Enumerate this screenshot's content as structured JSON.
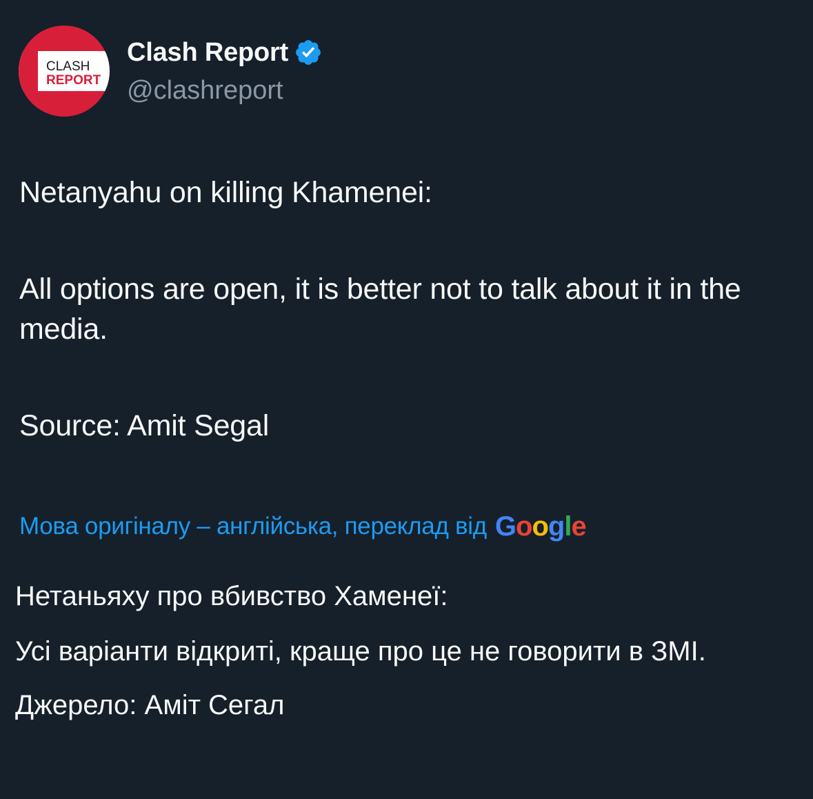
{
  "account": {
    "display_name": "Clash Report",
    "handle": "@clashreport",
    "avatar_logo_line1": "CLASH",
    "avatar_logo_line2": "REPORT",
    "verified": true,
    "avatar_color": "#d81f3a",
    "verified_color": "#1d9bf0"
  },
  "tweet": {
    "paragraphs": [
      "Netanyahu on killing Khamenei:",
      "All options are open, it is better not to talk about it in the media.",
      "Source: Amit Segal"
    ]
  },
  "translation": {
    "note": "Мова оригіналу – англійська, переклад від",
    "provider": "Google",
    "paragraphs": [
      "Нетаньяху про вбивство Хаменеї:",
      "Усі варіанти відкриті, краще про це не говорити в ЗМІ.",
      "Джерело: Аміт Сегал"
    ]
  },
  "colors": {
    "background": "#15202b",
    "text_primary": "#f7f9f9",
    "text_secondary": "#8b98a5",
    "link": "#1d9bf0"
  }
}
